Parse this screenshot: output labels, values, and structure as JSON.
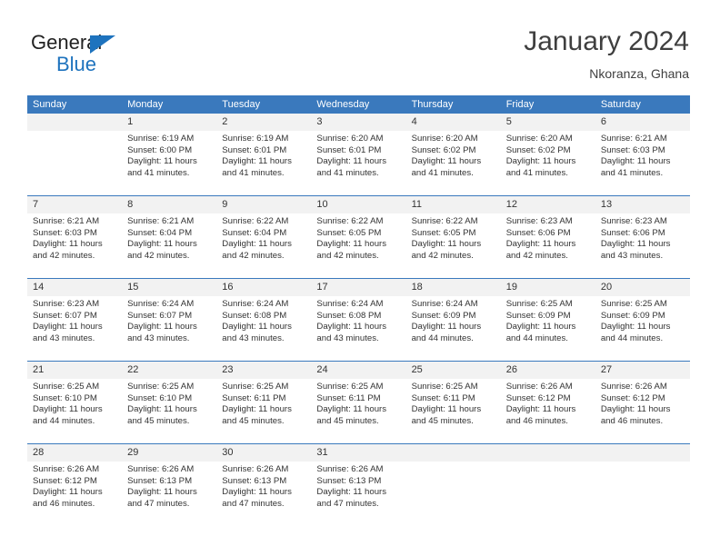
{
  "brand": {
    "name_part1": "General",
    "name_part2": "Blue",
    "triangle_color": "#1e73be",
    "text_color": "#222222"
  },
  "header": {
    "title": "January 2024",
    "subtitle": "Nkoranza, Ghana"
  },
  "theme": {
    "header_bg": "#3a79bd",
    "header_text": "#ffffff",
    "daynum_bg": "#f2f2f2",
    "cell_bg": "#ffffff",
    "text": "#333333",
    "separator": "#3a79bd"
  },
  "weekdays": [
    "Sunday",
    "Monday",
    "Tuesday",
    "Wednesday",
    "Thursday",
    "Friday",
    "Saturday"
  ],
  "weeks": [
    {
      "days": [
        {
          "num": "",
          "lines": []
        },
        {
          "num": "1",
          "lines": [
            "Sunrise: 6:19 AM",
            "Sunset: 6:00 PM",
            "Daylight: 11 hours",
            "and 41 minutes."
          ]
        },
        {
          "num": "2",
          "lines": [
            "Sunrise: 6:19 AM",
            "Sunset: 6:01 PM",
            "Daylight: 11 hours",
            "and 41 minutes."
          ]
        },
        {
          "num": "3",
          "lines": [
            "Sunrise: 6:20 AM",
            "Sunset: 6:01 PM",
            "Daylight: 11 hours",
            "and 41 minutes."
          ]
        },
        {
          "num": "4",
          "lines": [
            "Sunrise: 6:20 AM",
            "Sunset: 6:02 PM",
            "Daylight: 11 hours",
            "and 41 minutes."
          ]
        },
        {
          "num": "5",
          "lines": [
            "Sunrise: 6:20 AM",
            "Sunset: 6:02 PM",
            "Daylight: 11 hours",
            "and 41 minutes."
          ]
        },
        {
          "num": "6",
          "lines": [
            "Sunrise: 6:21 AM",
            "Sunset: 6:03 PM",
            "Daylight: 11 hours",
            "and 41 minutes."
          ]
        }
      ]
    },
    {
      "days": [
        {
          "num": "7",
          "lines": [
            "Sunrise: 6:21 AM",
            "Sunset: 6:03 PM",
            "Daylight: 11 hours",
            "and 42 minutes."
          ]
        },
        {
          "num": "8",
          "lines": [
            "Sunrise: 6:21 AM",
            "Sunset: 6:04 PM",
            "Daylight: 11 hours",
            "and 42 minutes."
          ]
        },
        {
          "num": "9",
          "lines": [
            "Sunrise: 6:22 AM",
            "Sunset: 6:04 PM",
            "Daylight: 11 hours",
            "and 42 minutes."
          ]
        },
        {
          "num": "10",
          "lines": [
            "Sunrise: 6:22 AM",
            "Sunset: 6:05 PM",
            "Daylight: 11 hours",
            "and 42 minutes."
          ]
        },
        {
          "num": "11",
          "lines": [
            "Sunrise: 6:22 AM",
            "Sunset: 6:05 PM",
            "Daylight: 11 hours",
            "and 42 minutes."
          ]
        },
        {
          "num": "12",
          "lines": [
            "Sunrise: 6:23 AM",
            "Sunset: 6:06 PM",
            "Daylight: 11 hours",
            "and 42 minutes."
          ]
        },
        {
          "num": "13",
          "lines": [
            "Sunrise: 6:23 AM",
            "Sunset: 6:06 PM",
            "Daylight: 11 hours",
            "and 43 minutes."
          ]
        }
      ]
    },
    {
      "days": [
        {
          "num": "14",
          "lines": [
            "Sunrise: 6:23 AM",
            "Sunset: 6:07 PM",
            "Daylight: 11 hours",
            "and 43 minutes."
          ]
        },
        {
          "num": "15",
          "lines": [
            "Sunrise: 6:24 AM",
            "Sunset: 6:07 PM",
            "Daylight: 11 hours",
            "and 43 minutes."
          ]
        },
        {
          "num": "16",
          "lines": [
            "Sunrise: 6:24 AM",
            "Sunset: 6:08 PM",
            "Daylight: 11 hours",
            "and 43 minutes."
          ]
        },
        {
          "num": "17",
          "lines": [
            "Sunrise: 6:24 AM",
            "Sunset: 6:08 PM",
            "Daylight: 11 hours",
            "and 43 minutes."
          ]
        },
        {
          "num": "18",
          "lines": [
            "Sunrise: 6:24 AM",
            "Sunset: 6:09 PM",
            "Daylight: 11 hours",
            "and 44 minutes."
          ]
        },
        {
          "num": "19",
          "lines": [
            "Sunrise: 6:25 AM",
            "Sunset: 6:09 PM",
            "Daylight: 11 hours",
            "and 44 minutes."
          ]
        },
        {
          "num": "20",
          "lines": [
            "Sunrise: 6:25 AM",
            "Sunset: 6:09 PM",
            "Daylight: 11 hours",
            "and 44 minutes."
          ]
        }
      ]
    },
    {
      "days": [
        {
          "num": "21",
          "lines": [
            "Sunrise: 6:25 AM",
            "Sunset: 6:10 PM",
            "Daylight: 11 hours",
            "and 44 minutes."
          ]
        },
        {
          "num": "22",
          "lines": [
            "Sunrise: 6:25 AM",
            "Sunset: 6:10 PM",
            "Daylight: 11 hours",
            "and 45 minutes."
          ]
        },
        {
          "num": "23",
          "lines": [
            "Sunrise: 6:25 AM",
            "Sunset: 6:11 PM",
            "Daylight: 11 hours",
            "and 45 minutes."
          ]
        },
        {
          "num": "24",
          "lines": [
            "Sunrise: 6:25 AM",
            "Sunset: 6:11 PM",
            "Daylight: 11 hours",
            "and 45 minutes."
          ]
        },
        {
          "num": "25",
          "lines": [
            "Sunrise: 6:25 AM",
            "Sunset: 6:11 PM",
            "Daylight: 11 hours",
            "and 45 minutes."
          ]
        },
        {
          "num": "26",
          "lines": [
            "Sunrise: 6:26 AM",
            "Sunset: 6:12 PM",
            "Daylight: 11 hours",
            "and 46 minutes."
          ]
        },
        {
          "num": "27",
          "lines": [
            "Sunrise: 6:26 AM",
            "Sunset: 6:12 PM",
            "Daylight: 11 hours",
            "and 46 minutes."
          ]
        }
      ]
    },
    {
      "days": [
        {
          "num": "28",
          "lines": [
            "Sunrise: 6:26 AM",
            "Sunset: 6:12 PM",
            "Daylight: 11 hours",
            "and 46 minutes."
          ]
        },
        {
          "num": "29",
          "lines": [
            "Sunrise: 6:26 AM",
            "Sunset: 6:13 PM",
            "Daylight: 11 hours",
            "and 47 minutes."
          ]
        },
        {
          "num": "30",
          "lines": [
            "Sunrise: 6:26 AM",
            "Sunset: 6:13 PM",
            "Daylight: 11 hours",
            "and 47 minutes."
          ]
        },
        {
          "num": "31",
          "lines": [
            "Sunrise: 6:26 AM",
            "Sunset: 6:13 PM",
            "Daylight: 11 hours",
            "and 47 minutes."
          ]
        },
        {
          "num": "",
          "lines": []
        },
        {
          "num": "",
          "lines": []
        },
        {
          "num": "",
          "lines": []
        }
      ]
    }
  ]
}
